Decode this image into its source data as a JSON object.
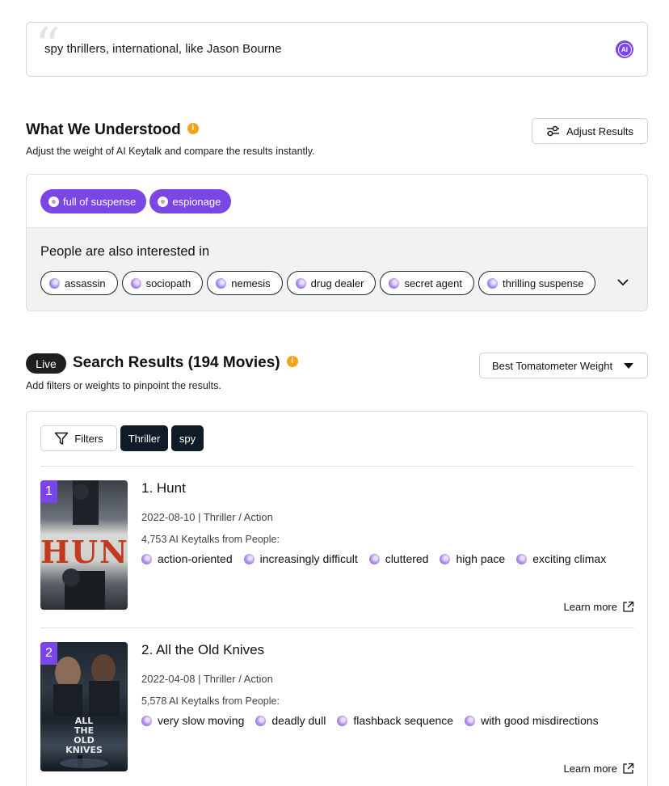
{
  "search": {
    "query": "spy thrillers, international, like Jason Bourne",
    "ai_badge": "AI"
  },
  "understood": {
    "title": "What We Understood",
    "subtitle": "Adjust the weight of AI Keytalk and compare the results instantly.",
    "adjust_label": "Adjust Results",
    "main_tags": [
      "full of suspense",
      "espionage"
    ],
    "also_title": "People are also interested in",
    "also_tags": [
      "assassin",
      "sociopath",
      "nemesis",
      "drug dealer",
      "secret agent",
      "thrilling suspense"
    ]
  },
  "results": {
    "live_label": "Live",
    "title": "Search Results (194 Movies)",
    "subtitle": "Add filters or weights to pinpoint the results.",
    "sort_label": "Best Tomatometer Weight",
    "filters_label": "Filters",
    "active_filters": [
      "Thriller",
      "spy"
    ],
    "movies": [
      {
        "rank": "1",
        "title": "1. Hunt",
        "meta": "2022-08-10 | Thriller / Action",
        "count": "4,753 AI Keytalks from People:",
        "keywords": [
          "action-oriented",
          "increasingly difficult",
          "cluttered",
          "high pace",
          "exciting climax"
        ],
        "poster_text": "HUNT",
        "learn_more": "Learn more"
      },
      {
        "rank": "2",
        "title": "2. All the Old Knives",
        "meta": "2022-04-08 | Thriller / Action",
        "count": "5,578 AI Keytalks from People:",
        "keywords": [
          "very slow moving",
          "deadly dull",
          "flashback sequence",
          "with good misdirections"
        ],
        "poster_text": "ALL THE OLD KNIVES",
        "learn_more": "Learn more"
      }
    ]
  },
  "colors": {
    "accent": "#7a46e6",
    "info": "#f2a31b",
    "dark_chip": "#0f1b27"
  }
}
